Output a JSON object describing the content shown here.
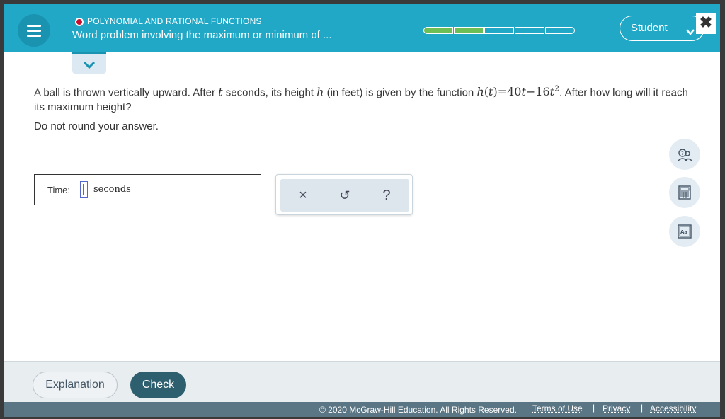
{
  "header": {
    "topic": "POLYNOMIAL AND RATIONAL FUNCTIONS",
    "title": "Word problem involving the maximum or minimum of ...",
    "progress": {
      "completed": 2,
      "total": 5
    },
    "student_label": "Student",
    "icons": {
      "menu": "hamburger-menu-icon",
      "close": "close-icon",
      "chevron": "chevron-down-icon"
    }
  },
  "question": {
    "p1": "A ball is thrown vertically upward. After",
    "var_t": "t",
    "p2": "seconds, its height",
    "var_h": "h",
    "p3": "(in feet) is given by the function",
    "fn_h": "h",
    "fn_t": "t",
    "fn_eq": "=40",
    "fn_t2": "t",
    "fn_minus": "−16",
    "fn_t3": "t",
    "fn_exp": "2",
    "p4": ". After how long will it reach its maximum height?",
    "instruction": "Do not round your answer."
  },
  "answer": {
    "label": "Time:",
    "value": "",
    "unit": "seconds"
  },
  "tools": {
    "clear": "×",
    "undo": "↺",
    "help": "?"
  },
  "side_tools": [
    "ask-help-icon",
    "calculator-icon",
    "dictionary-icon"
  ],
  "footer": {
    "explanation": "Explanation",
    "check": "Check",
    "copyright": "© 2020 McGraw-Hill Education. All Rights Reserved.",
    "terms": "Terms of Use",
    "privacy": "Privacy",
    "accessibility": "Accessibility",
    "separator": "|"
  },
  "colors": {
    "header": "#21a8c7",
    "progress_done": "#6dbf55",
    "check_button": "#2e5f6e",
    "bottom_bar": "#5a7583"
  }
}
